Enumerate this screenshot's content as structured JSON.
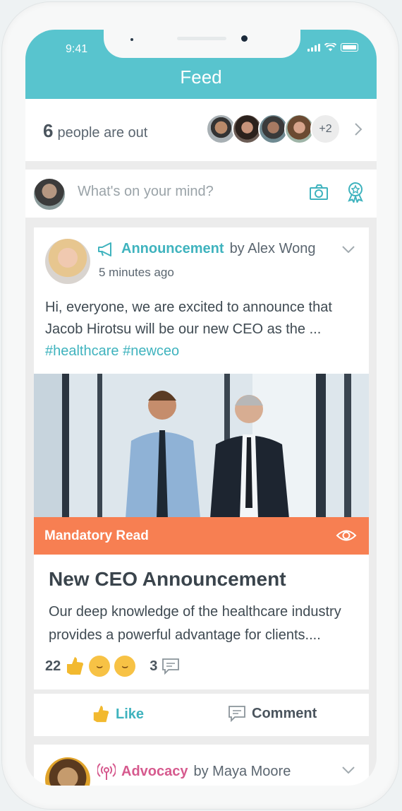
{
  "status": {
    "time": "9:41"
  },
  "header": {
    "title": "Feed"
  },
  "out": {
    "count": "6",
    "label": "people are out",
    "more": "+2"
  },
  "composer": {
    "placeholder": "What's on your mind?"
  },
  "post1": {
    "category": "Announcement",
    "by": "by Alex Wong",
    "time": "5 minutes ago",
    "body": "Hi, everyone, we are excited to announce that Jacob Hirotsu will be our new CEO as the ...",
    "tags": "#healthcare #newceo",
    "banner": "Mandatory Read",
    "article_title": "New CEO Announcement",
    "article_desc": "Our deep knowledge of the healthcare industry provides a powerful advantage for clients....",
    "reaction_count": "22",
    "comment_count": "3"
  },
  "actions": {
    "like": "Like",
    "comment": "Comment"
  },
  "post2": {
    "category": "Advocacy",
    "by": "by Maya Moore"
  },
  "colors": {
    "accent": "#58c4ce",
    "banner": "#f77f52",
    "advocacy": "#d65a8e"
  }
}
